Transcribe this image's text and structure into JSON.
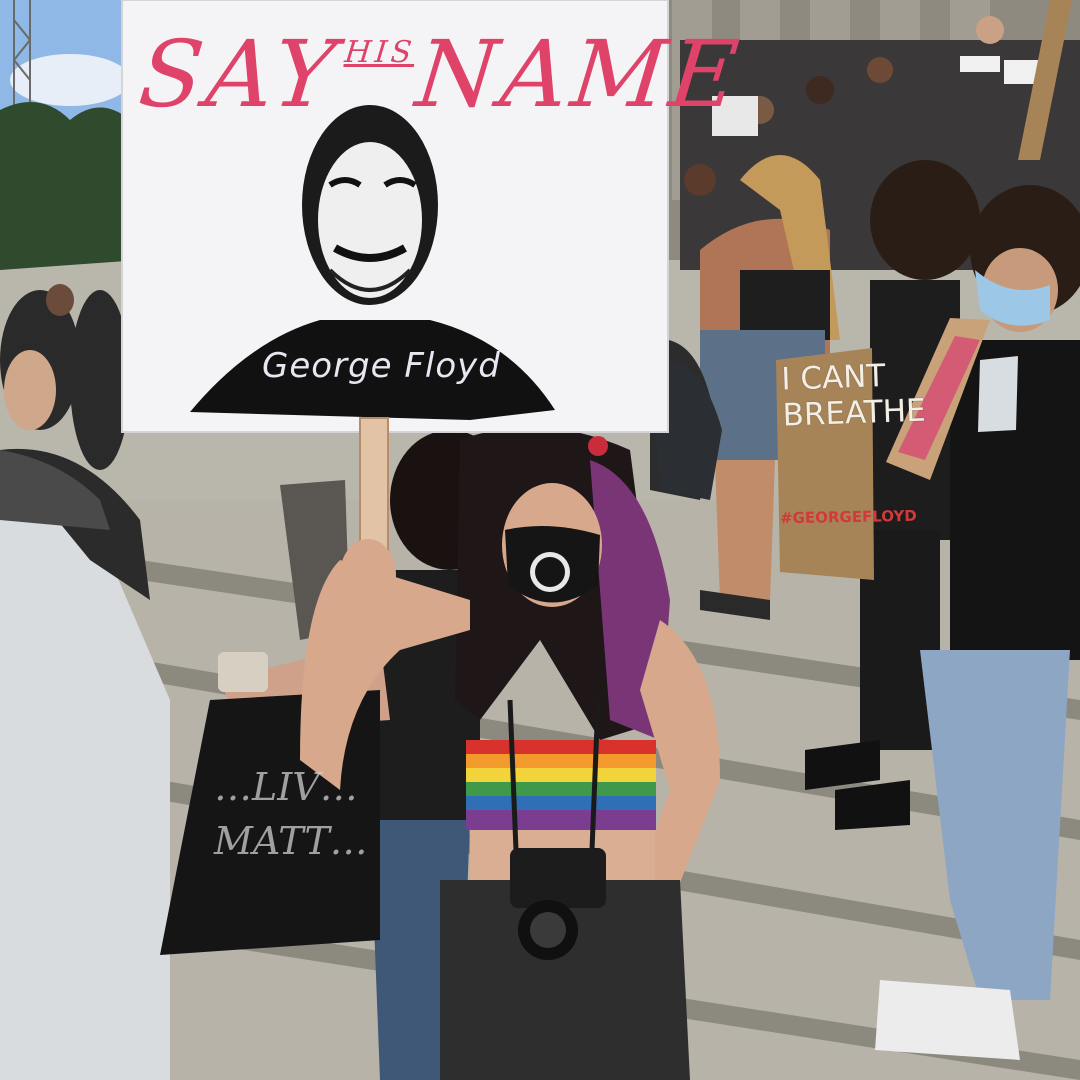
{
  "scene": {
    "main_sign": {
      "line1_say": "SAY",
      "line1_his": "HIS",
      "line1_name": "NAME",
      "caption": "George Floyd"
    },
    "right_sign": {
      "line1": "I CANT",
      "line2": "BREATHE",
      "hashtag": "#GEORGEFLOYD"
    },
    "ground_sign": {
      "text": "…LIV… MATT…"
    },
    "colors": {
      "sign_red": "#e0436a",
      "sky": "#8fb8e6",
      "steps": "#b9b6ac",
      "cardboard": "#a78457",
      "rainbow_top": [
        "#d9322c",
        "#f29a2b",
        "#f3d33a",
        "#3e9a4a",
        "#2e6fb6",
        "#7a3d8f"
      ]
    }
  }
}
